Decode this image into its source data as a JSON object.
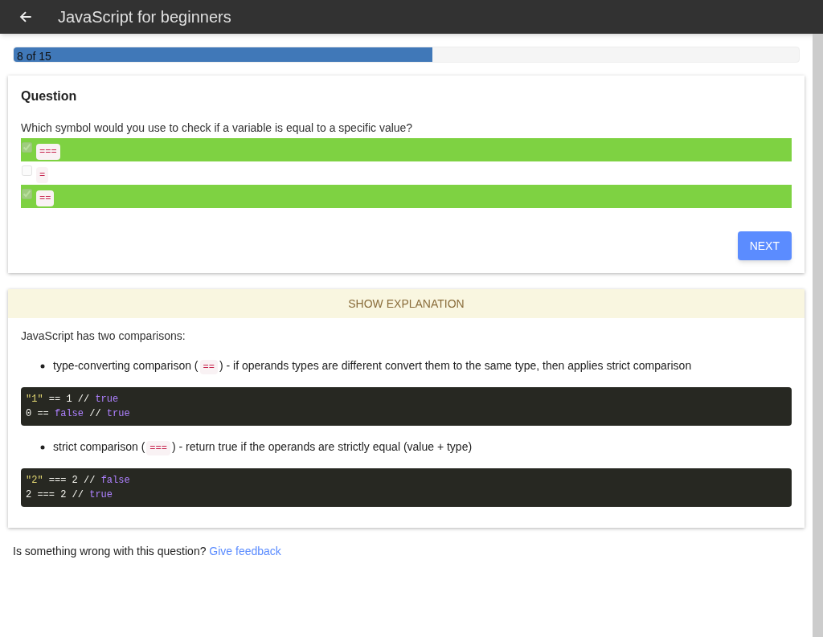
{
  "app_bar": {
    "title": "JavaScript for beginners"
  },
  "progress": {
    "label": "8 of 15",
    "level": 0.533
  },
  "question": {
    "heading": "Question",
    "text": "Which symbol would you use to check if a variable is equal to a specific value?",
    "options": [
      {
        "text": "===",
        "checked": true,
        "correct": true
      },
      {
        "text": "=",
        "checked": false,
        "correct": false
      },
      {
        "text": "==",
        "checked": true,
        "correct": true
      }
    ],
    "next_button": "NEXT"
  },
  "explanation": {
    "toggle": "SHOW EXPLANATION",
    "intro": "JavaScript has two comparisons:",
    "items": [
      {
        "parts": [
          {
            "kind": "text",
            "text": "type-converting comparison ("
          },
          {
            "kind": "code",
            "text": "=="
          },
          {
            "kind": "text",
            "text": ") - if operands types are different convert them to the same type, then applies strict comparison"
          }
        ],
        "code": [
          [
            {
              "kind": "string",
              "text": "\"1\""
            },
            {
              "kind": "plain",
              "text": " == 1 // "
            },
            {
              "kind": "keyword",
              "text": "true"
            }
          ],
          [
            {
              "kind": "plain",
              "text": "0 == "
            },
            {
              "kind": "keyword",
              "text": "false"
            },
            {
              "kind": "plain",
              "text": " // "
            },
            {
              "kind": "keyword",
              "text": "true"
            }
          ]
        ]
      },
      {
        "parts": [
          {
            "kind": "text",
            "text": "strict comparison ("
          },
          {
            "kind": "code",
            "text": "==="
          },
          {
            "kind": "text",
            "text": ") - return true if the operands are strictly equal (value + type)"
          }
        ],
        "code": [
          [
            {
              "kind": "string",
              "text": "\"2\""
            },
            {
              "kind": "plain",
              "text": " === 2 // "
            },
            {
              "kind": "keyword",
              "text": "false"
            }
          ],
          [
            {
              "kind": "plain",
              "text": "2 === 2 // "
            },
            {
              "kind": "keyword",
              "text": "true"
            }
          ]
        ]
      }
    ]
  },
  "feedback": {
    "text": "Is something wrong with this question?",
    "link": "Give feedback"
  }
}
